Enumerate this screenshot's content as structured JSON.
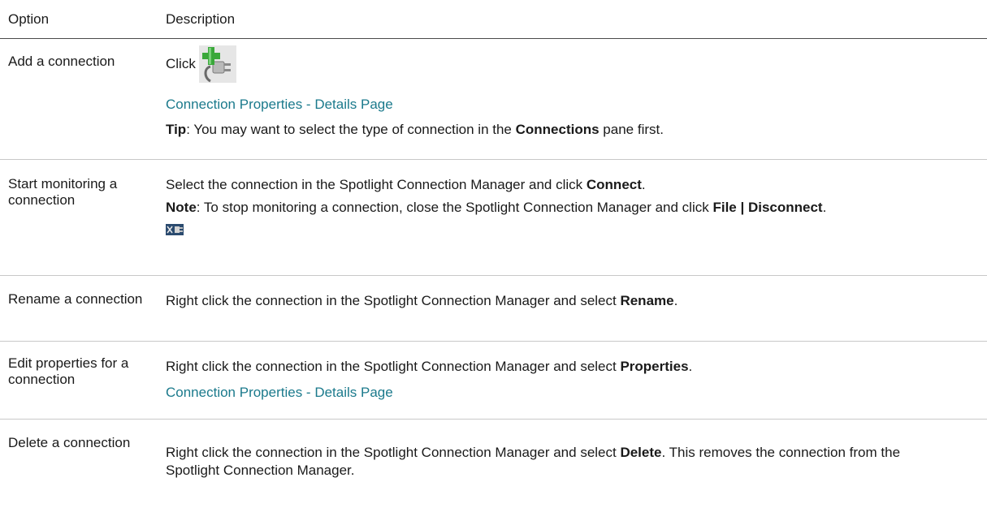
{
  "header": {
    "option": "Option",
    "description": "Description"
  },
  "rows": [
    {
      "option": "Add a connection",
      "click_label": "Click",
      "icon": "add-connection-icon",
      "link": "Connection Properties - Details Page",
      "tip_label": "Tip",
      "tip_text_1": ": You may want to select the type of connection in the ",
      "tip_bold": "Connections",
      "tip_text_2": " pane first."
    },
    {
      "option": "Start monitoring a connection",
      "desc_1": "Select the connection in the Spotlight Connection Manager and click ",
      "desc_bold": "Connect",
      "desc_end": ".",
      "note_label": "Note",
      "note_text": ": To stop monitoring a connection, close the Spotlight Connection Manager and click ",
      "note_bold": "File | Disconnect",
      "note_end": ".",
      "icon": "disconnect-icon"
    },
    {
      "option": "Rename a connection",
      "desc_1": "Right click the connection in the Spotlight Connection Manager and select ",
      "desc_bold": "Rename",
      "desc_end": "."
    },
    {
      "option": "Edit properties for a connection",
      "desc_1": "Right click the connection in the Spotlight Connection Manager and select ",
      "desc_bold": "Properties",
      "desc_end": ".",
      "link": "Connection Properties - Details Page"
    },
    {
      "option": "Delete a connection",
      "desc_1": "Right click the connection in the Spotlight Connection Manager and select ",
      "desc_bold": "Delete",
      "desc_end": ". This removes the connection from the Spotlight Connection Manager."
    }
  ]
}
